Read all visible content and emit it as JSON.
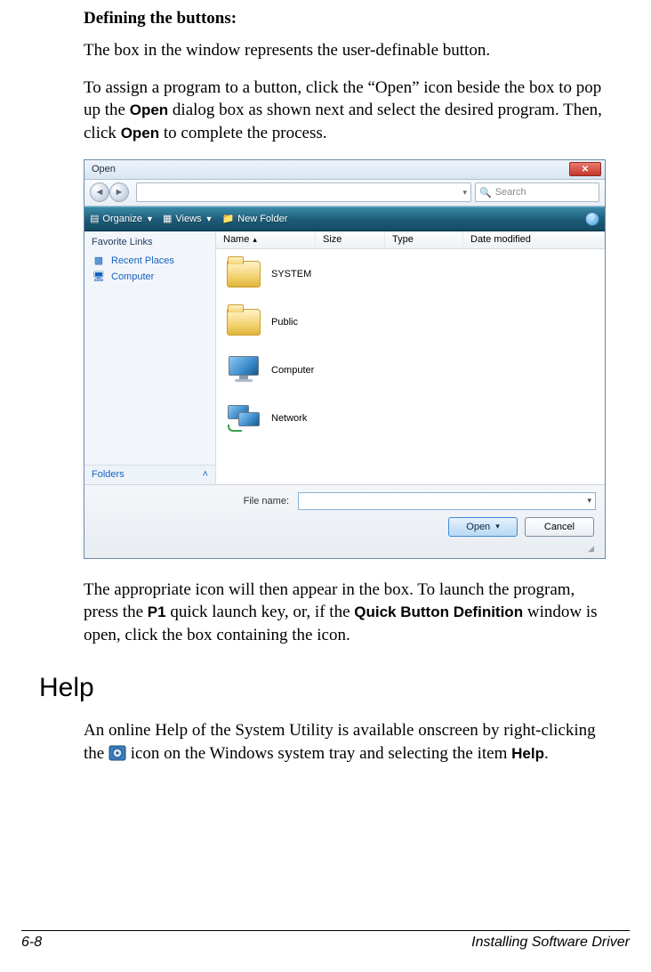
{
  "doc": {
    "heading_def": "Defining the buttons:",
    "para1": "The box in the window represents the user-definable button.",
    "para2_a": "To assign a program to a button, click the “Open” icon beside the box to pop up the ",
    "para2_b_bold": "Open",
    "para2_c": " dialog box as shown next and select the desired program. Then, click ",
    "para2_d_bold": "Open",
    "para2_e": " to complete the process.",
    "para3_a": "The appropriate icon will then appear in the box. To launch the program, press the ",
    "para3_b_bold": "P1",
    "para3_c": " quick launch key, or, if the ",
    "para3_d_bold": "Quick Button Definition",
    "para3_e": " window is open, click the box containing the icon.",
    "h2_help": "Help",
    "para4_a": "An online Help of the System Utility is available onscreen by right-clicking the ",
    "para4_b": " icon on the Windows system tray and selecting the item ",
    "para4_c_bold": "Help",
    "para4_d": "."
  },
  "dialog": {
    "title": "Open",
    "search_placeholder": "Search",
    "toolbar": {
      "organize": "Organize",
      "views": "Views",
      "new_folder": "New Folder"
    },
    "sidebar": {
      "heading": "Favorite Links",
      "recent": "Recent Places",
      "computer": "Computer",
      "folders": "Folders"
    },
    "columns": {
      "name": "Name",
      "size": "Size",
      "type": "Type",
      "date": "Date modified"
    },
    "items": {
      "system": "SYSTEM",
      "public": "Public",
      "computer": "Computer",
      "network": "Network"
    },
    "filename_label": "File name:",
    "btn_open": "Open",
    "btn_cancel": "Cancel"
  },
  "footer": {
    "page": "6-8",
    "section": "Installing Software Driver"
  }
}
